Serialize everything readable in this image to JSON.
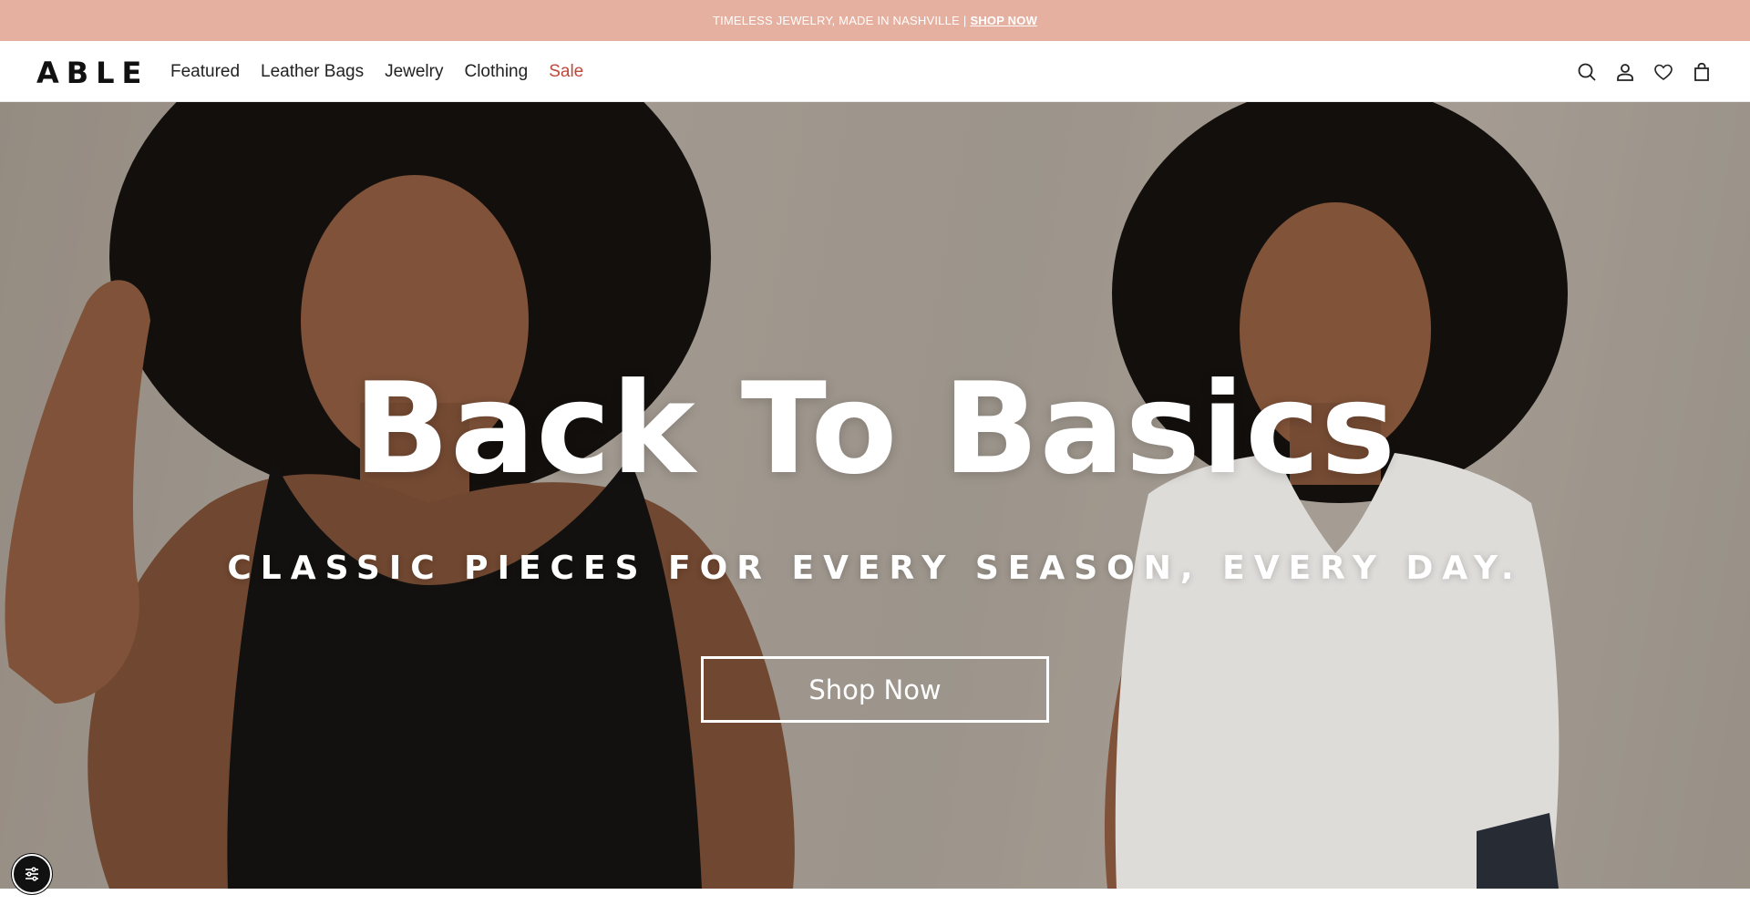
{
  "announcement": {
    "text": "TIMELESS JEWELRY, MADE IN NASHVILLE",
    "separator": "|",
    "link_label": "SHOP NOW"
  },
  "header": {
    "logo": "ABLE",
    "nav": [
      {
        "label": "Featured"
      },
      {
        "label": "Leather Bags"
      },
      {
        "label": "Jewelry"
      },
      {
        "label": "Clothing"
      },
      {
        "label": "Sale",
        "accent": "#c0483a"
      }
    ],
    "icons": [
      "search-icon",
      "account-icon",
      "wishlist-heart-icon",
      "cart-bag-icon"
    ]
  },
  "hero": {
    "title": "Back To Basics",
    "subtitle": "CLASSIC PIECES FOR EVERY SEASON, EVERY DAY.",
    "cta_label": "Shop Now"
  },
  "accessibility": {
    "icon": "accessibility-settings-icon"
  },
  "colors": {
    "announcement_bg": "#e5b0a0",
    "sale_accent": "#c0483a",
    "hero_text": "#ffffff"
  }
}
